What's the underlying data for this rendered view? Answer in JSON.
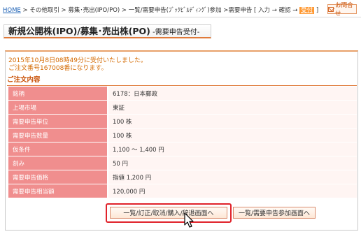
{
  "breadcrumb": {
    "home": "HOME",
    "path": " > その他取引 > 募集･売出(IPO/PO) > 一覧/需要申告(ﾌﾞｯｸﾋﾞﾙﾃﾞｨﾝｸﾞ)参加 >需要申告 [ 入力 → 確認 → ",
    "current": "受付",
    "end": " ]"
  },
  "inquiry": {
    "label": "お問合せ"
  },
  "page_title": {
    "main": "新規公開株(IPO)/募集･売出株(PO)",
    "sub": " -需要申告受付-"
  },
  "notice": {
    "line1": "2015年10月8日08時49分に受付いたしました。",
    "line2": "ご注文番号167008番になります。"
  },
  "order_section": {
    "title": "ご注文内容",
    "rows": [
      {
        "label": "銘柄",
        "value": "6178：日本郵政"
      },
      {
        "label": "上場市場",
        "value": "東証"
      },
      {
        "label": "需要申告単位",
        "value": "100 株"
      },
      {
        "label": "需要申告数量",
        "value": "100 株"
      },
      {
        "label": "仮条件",
        "value": "1,100 ～ 1,400 円"
      },
      {
        "label": "刻み",
        "value": "50 円"
      },
      {
        "label": "需要申告価格",
        "value": "指値 1,200 円"
      },
      {
        "label": "需要申告相当額",
        "value": "120,000 円"
      }
    ]
  },
  "buttons": {
    "list_button": "一覧/訂正/取消/購入/辞退画面へ",
    "participate_button": "一覧/需要申告参加画面へ"
  }
}
